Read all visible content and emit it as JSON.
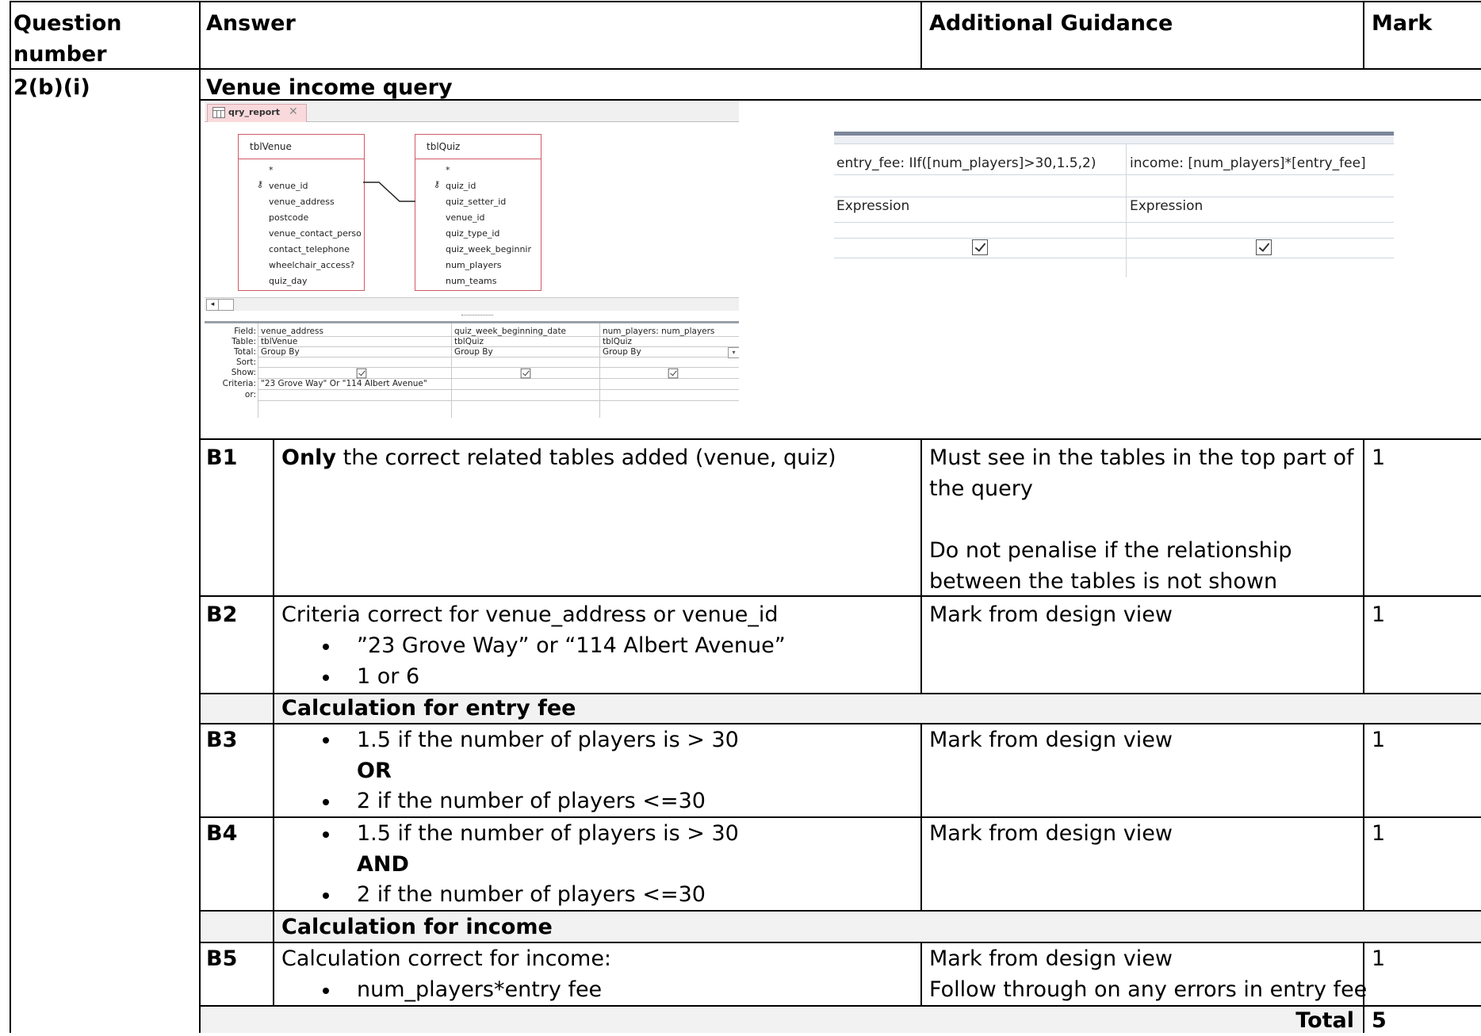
{
  "header": {
    "question_number": "Question number",
    "question_number_l1": "Question",
    "question_number_l2": "number",
    "answer": "Answer",
    "guidance": "Additional Guidance",
    "mark": "Mark"
  },
  "question": {
    "id": "2(b)(i)",
    "title": "Venue income query"
  },
  "access": {
    "tab_label": "qry_report",
    "tables": [
      {
        "name": "tblVenue",
        "fields": [
          "*",
          "venue_id",
          "venue_address",
          "postcode",
          "venue_contact_perso",
          "contact_telephone",
          "wheelchair_access?",
          "quiz_day"
        ]
      },
      {
        "name": "tblQuiz",
        "fields": [
          "*",
          "quiz_id",
          "quiz_setter_id",
          "venue_id",
          "quiz_type_id",
          "quiz_week_beginnir",
          "num_players",
          "num_teams"
        ]
      }
    ],
    "grid_labels": [
      "Field:",
      "Table:",
      "Total:",
      "Sort:",
      "Show:",
      "Criteria:",
      "or:"
    ],
    "columns": [
      {
        "field": "venue_address",
        "table": "tblVenue",
        "total": "Group By",
        "criteria": "\"23 Grove Way\" Or \"114 Albert Avenue\""
      },
      {
        "field": "quiz_week_beginning_date",
        "table": "tblQuiz",
        "total": "Group By",
        "criteria": ""
      },
      {
        "field": "num_players: num_players",
        "table": "tblQuiz",
        "total": "Group By",
        "criteria": ""
      }
    ]
  },
  "expressions": {
    "col1_field": "entry_fee: IIf([num_players]>30,1.5,2)",
    "col2_field": "income: [num_players]*[entry_fee]",
    "col1_total": "Expression",
    "col2_total": "Expression"
  },
  "rows": {
    "b1": {
      "code": "B1",
      "answer_bold": "Only",
      "answer_rest": " the correct related tables added (venue, quiz)",
      "guidance_l1": "Must see in the tables in the top part of",
      "guidance_l2": "the query",
      "guidance_l3": "Do not penalise if the relationship",
      "guidance_l4": "between the tables is not shown",
      "mark": "1"
    },
    "b2": {
      "code": "B2",
      "answer": "Criteria correct for venue_address or venue_id",
      "bullet1": "”23 Grove Way” or “114 Albert Avenue”",
      "bullet2": "1 or 6",
      "guidance": "Mark from design view",
      "mark": "1"
    },
    "entry_heading": "Calculation for entry fee",
    "b3": {
      "code": "B3",
      "bullet1": "1.5 if the number of players is > 30",
      "connector": "OR",
      "bullet2": "2 if the number of players <=30",
      "guidance": "Mark from design view",
      "mark": "1"
    },
    "b4": {
      "code": "B4",
      "bullet1": "1.5 if the number of players is > 30",
      "connector": "AND",
      "bullet2": "2 if the number of players <=30",
      "guidance": "Mark from design view",
      "mark": "1"
    },
    "income_heading": "Calculation for income",
    "b5": {
      "code": "B5",
      "answer": "Calculation correct for income:",
      "bullet1": "num_players*entry fee",
      "guidance_l1": "Mark from design view",
      "guidance_l2": "Follow through on any errors in entry fee",
      "mark": "1"
    },
    "total_label": "Total",
    "total_value": "5"
  }
}
